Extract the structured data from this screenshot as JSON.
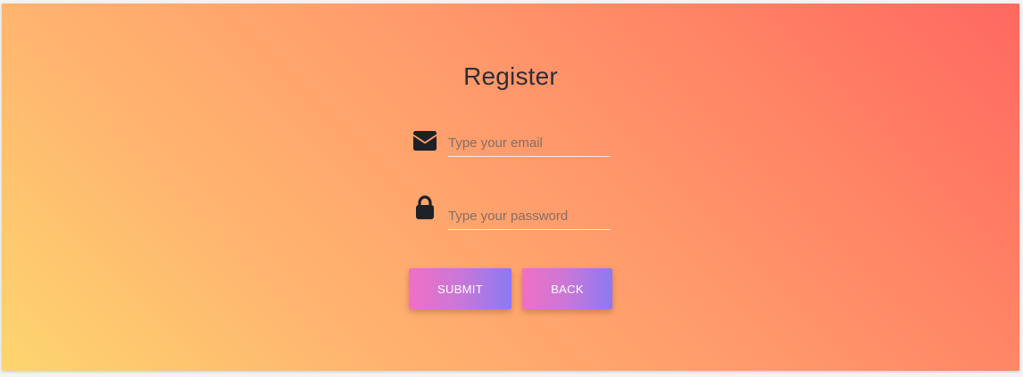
{
  "page": {
    "title": "Register"
  },
  "form": {
    "email": {
      "placeholder": "Type your email",
      "value": ""
    },
    "password": {
      "placeholder": "Type your password",
      "value": ""
    },
    "buttons": {
      "submit_label": "SUBMIT",
      "back_label": "BACK"
    }
  },
  "icons": {
    "email": "envelope-icon",
    "password": "lock-icon"
  },
  "colors": {
    "background_start": "#fdd56f",
    "background_end": "#ff6861",
    "button_start": "#f070c4",
    "button_end": "#8b79f3",
    "title": "#2f2d34",
    "icon": "#1f2128",
    "underline": "#ffffff"
  }
}
